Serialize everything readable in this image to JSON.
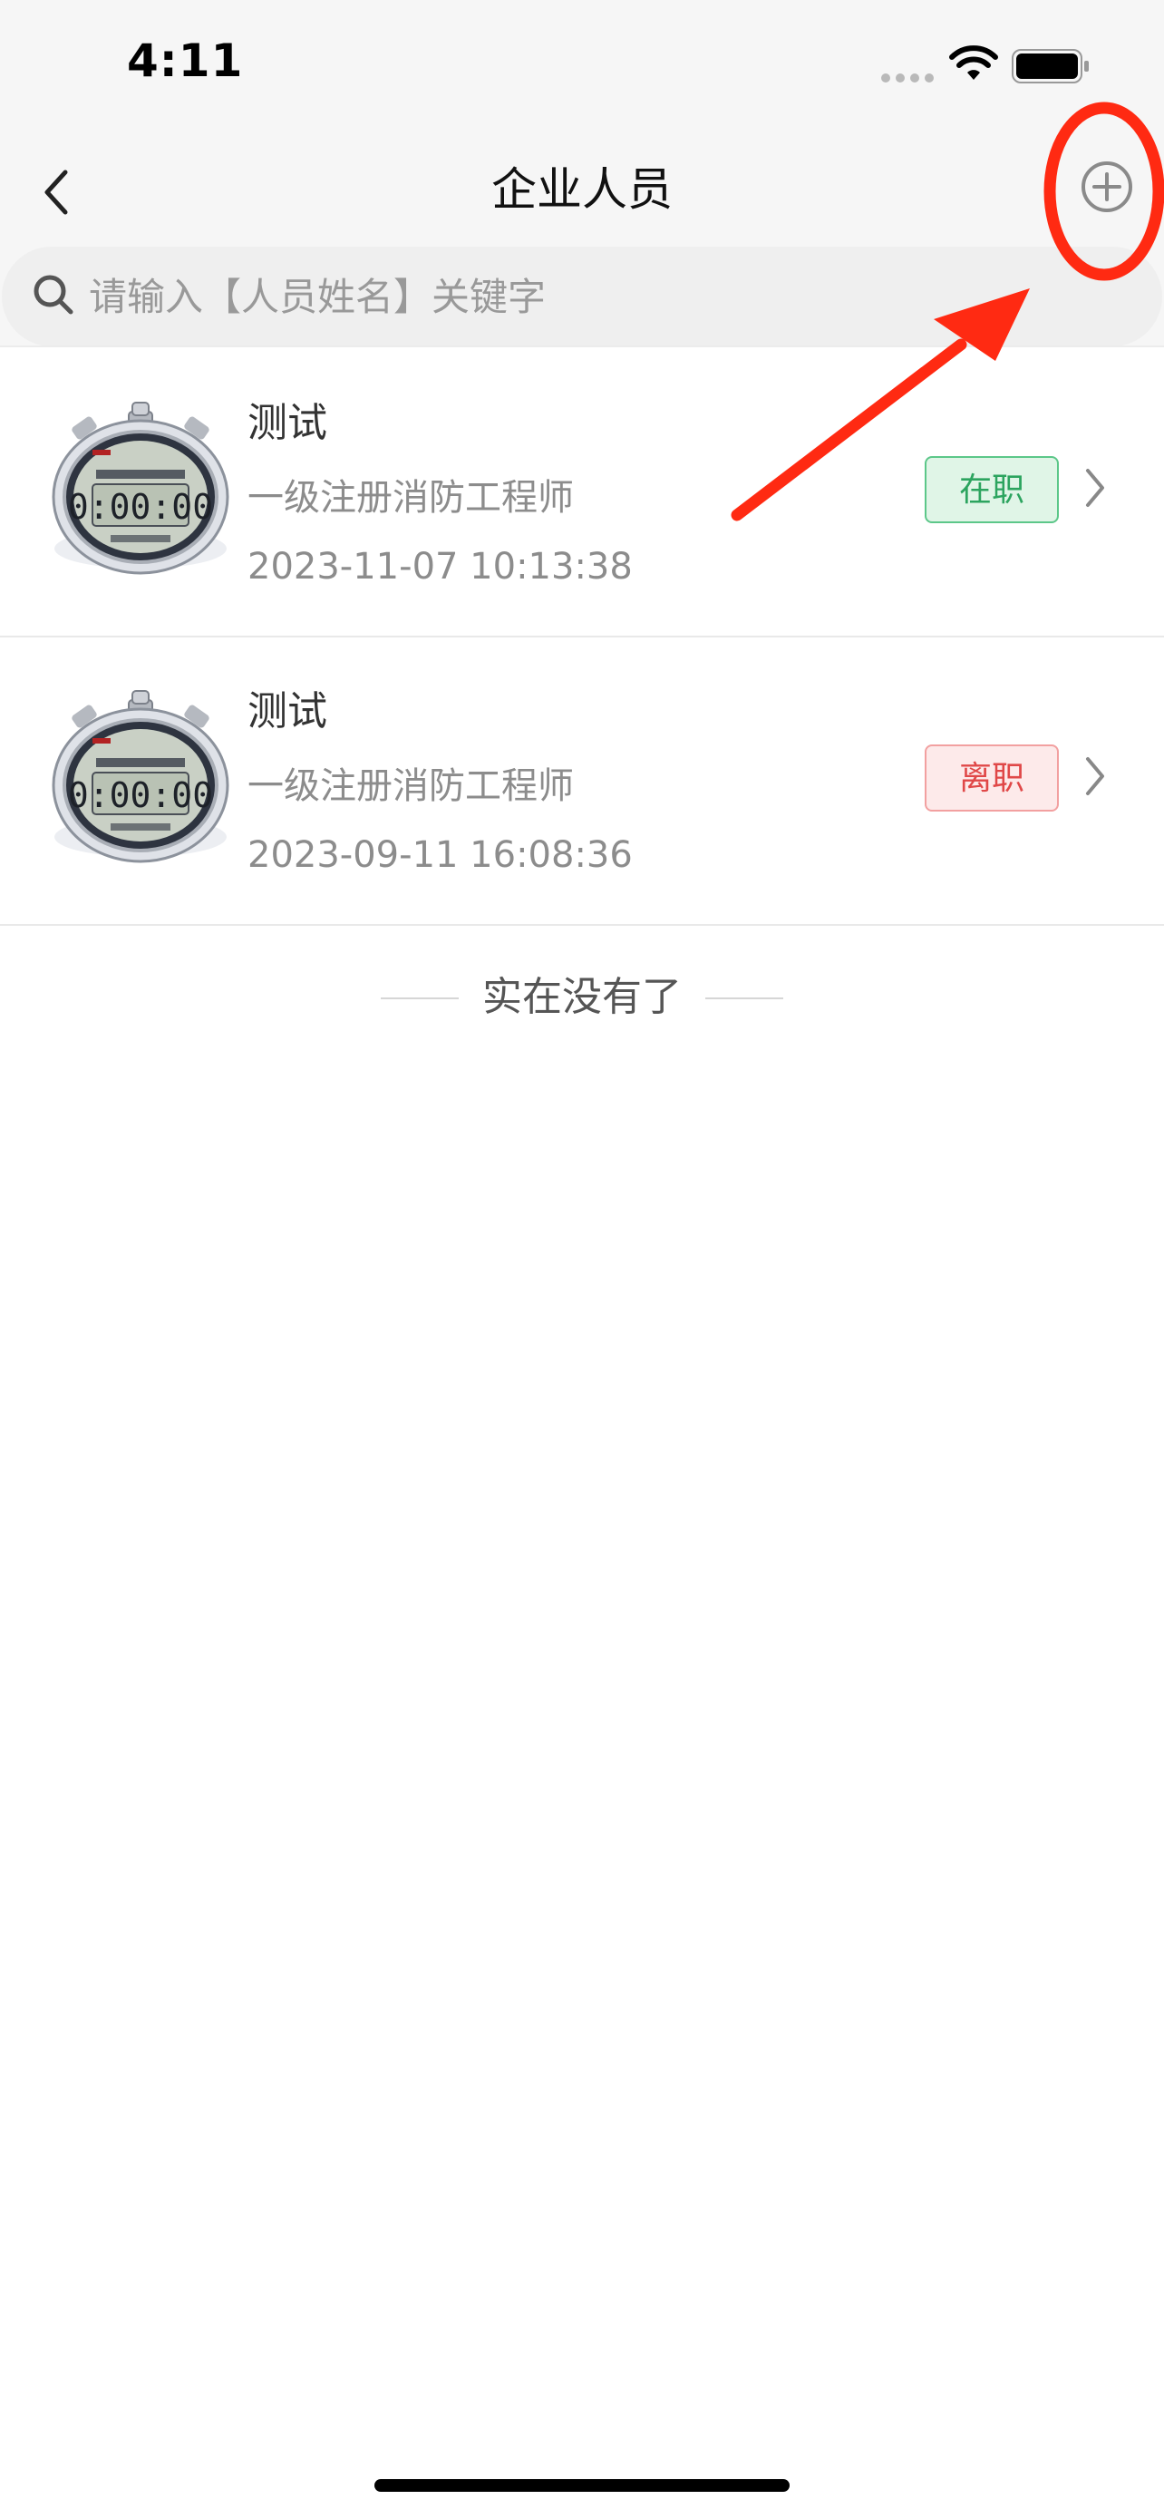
{
  "status_bar": {
    "time": "4:11",
    "icons": [
      "signal-dots-icon",
      "wifi-icon",
      "battery-icon"
    ]
  },
  "nav": {
    "title": "企业人员",
    "back_icon": "chevron-left-icon",
    "add_icon": "plus-circle-icon"
  },
  "search": {
    "placeholder": "请输入【人员姓名】关键字",
    "value": "",
    "icon": "search-icon"
  },
  "items": [
    {
      "name": "测试",
      "role": "一级注册消防工程师",
      "time": "2023-11-07 10:13:38",
      "status": "在职",
      "status_color": "#2ca45f",
      "avatar": "stopwatch-image"
    },
    {
      "name": "测试",
      "role": "一级注册消防工程师",
      "time": "2023-09-11 16:08:36",
      "status": "离职",
      "status_color": "#e04848",
      "avatar": "stopwatch-image"
    }
  ],
  "list_end_text": "实在没有了",
  "annotation": {
    "color": "#ff2a12",
    "shapes": [
      "highlight-ellipse",
      "pointer-arrow"
    ]
  }
}
